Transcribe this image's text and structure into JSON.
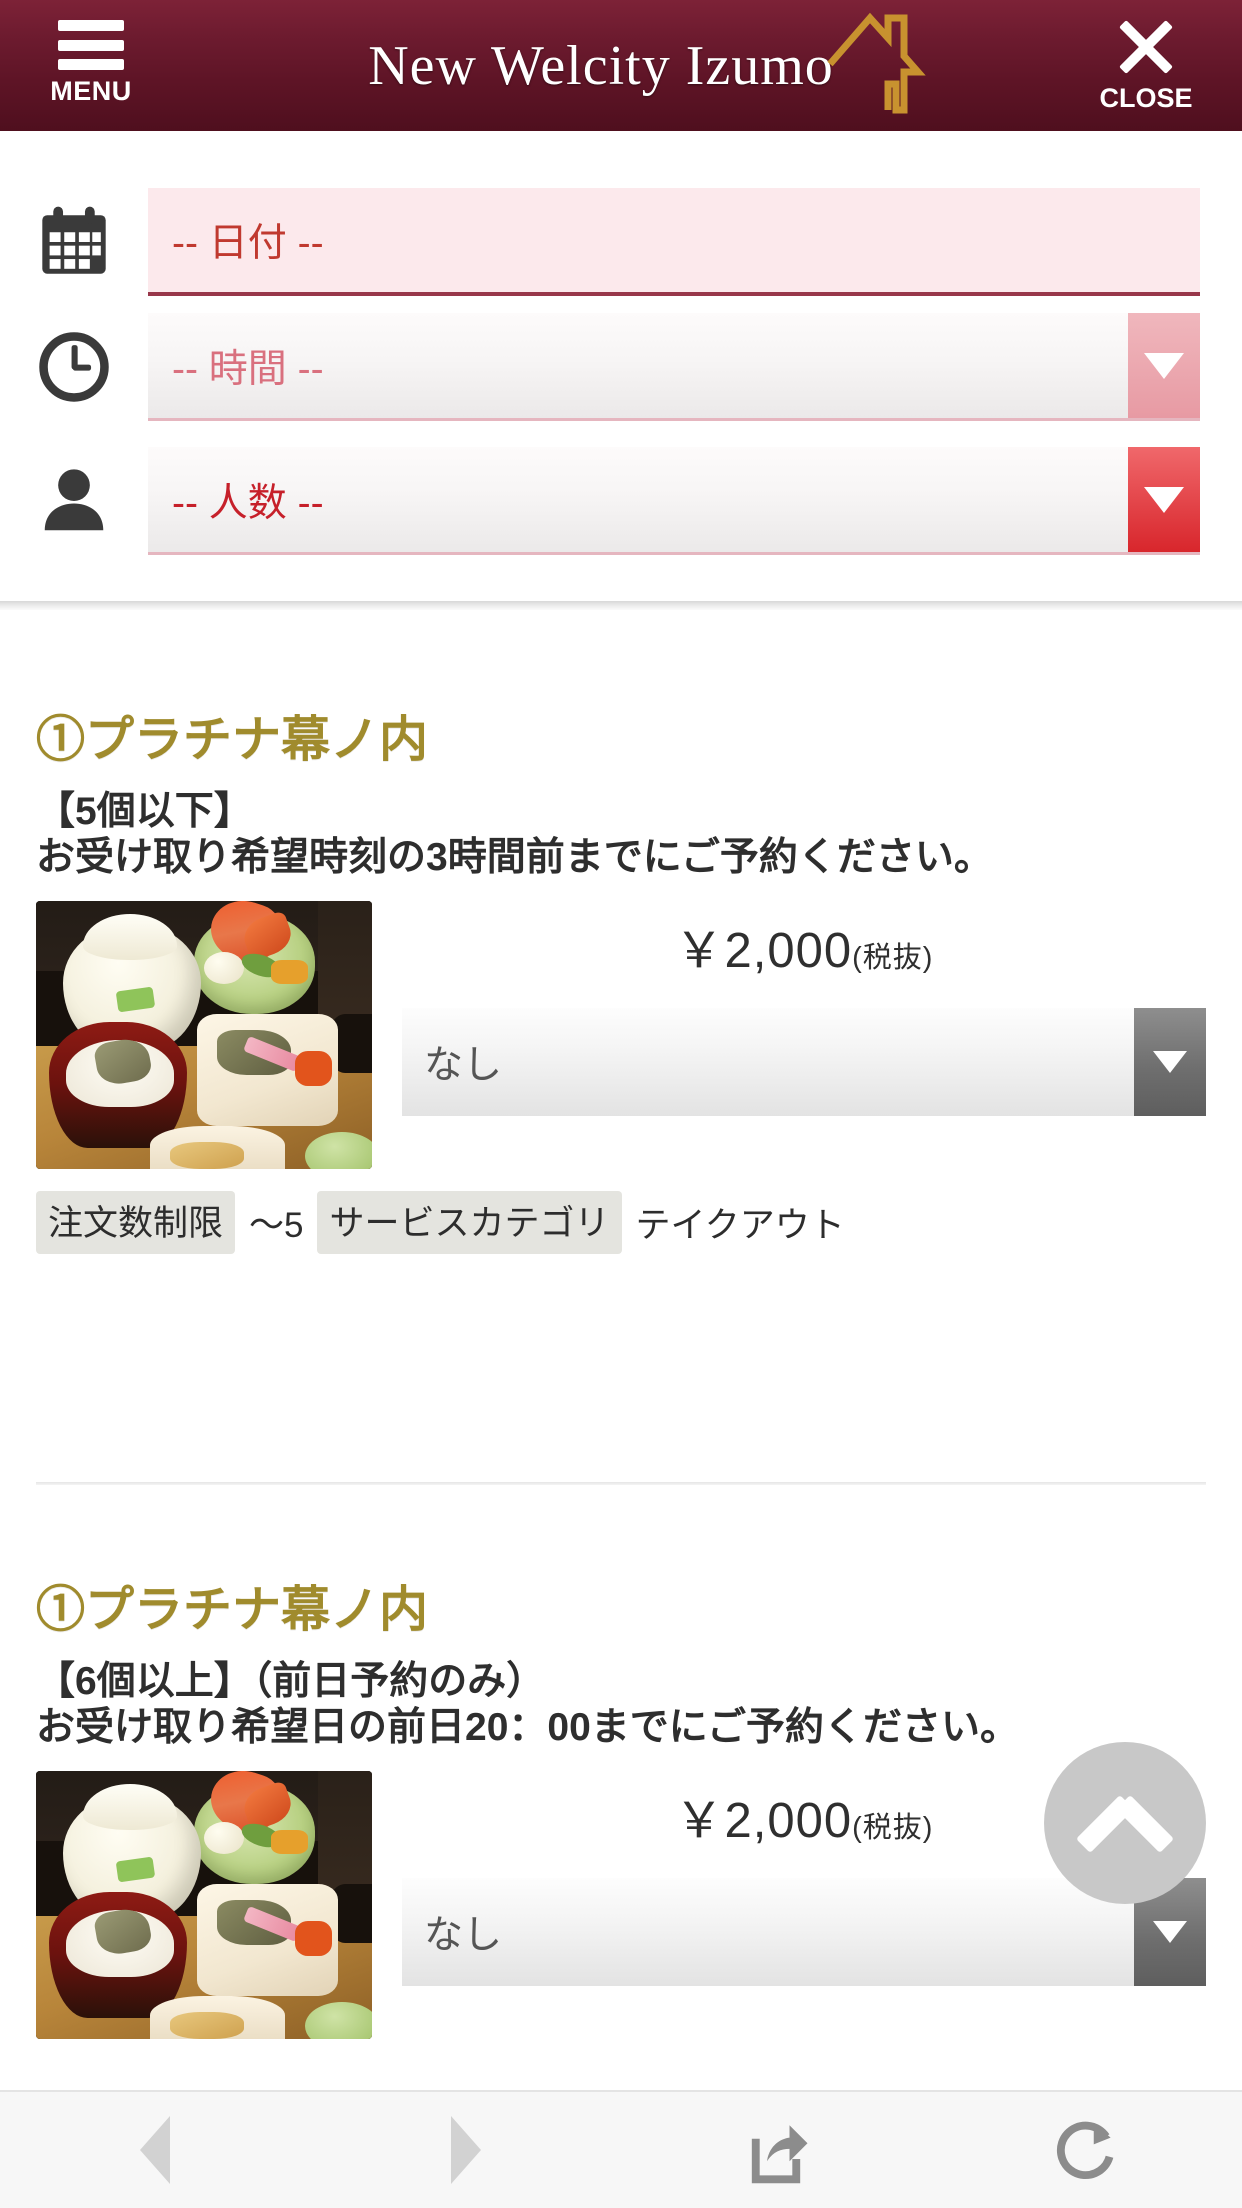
{
  "header": {
    "menu_label": "MENU",
    "title": "New Welcity Izumo",
    "close_label": "CLOSE",
    "brand_color": "#5e1426",
    "logo_color": "#c8922f"
  },
  "search_form": {
    "date": {
      "icon": "calendar-icon",
      "placeholder": "-- 日付 --",
      "value": "-- 日付 --"
    },
    "time": {
      "icon": "clock-icon",
      "placeholder": "-- 時間 --",
      "value": "-- 時間 --"
    },
    "people": {
      "icon": "person-icon",
      "placeholder": "-- 人数 --",
      "value": "-- 人数 --"
    }
  },
  "products": [
    {
      "title": "①プラチナ幕ノ内",
      "desc_line1": "【5個以下】",
      "desc_line2": "お受け取り希望時刻の3時間前までにご予約ください。",
      "price": "￥2,000",
      "tax_note": "(税抜)",
      "qty_value": "なし",
      "tags": [
        {
          "label": "注文数制限",
          "value": "～5"
        },
        {
          "label": "サービスカテゴリ",
          "value": "テイクアウト"
        }
      ]
    },
    {
      "title": "①プラチナ幕ノ内",
      "desc_line1": "【6個以上】（前日予約のみ）",
      "desc_line2": "お受け取り希望日の前日20：00までにご予約ください。",
      "price": "￥2,000",
      "tax_note": "(税抜)",
      "qty_value": "なし",
      "tags": []
    }
  ],
  "scroll_top": {
    "icon": "chevron-up-icon"
  },
  "bottom_bar": {
    "items": [
      {
        "icon": "back-arrow-icon",
        "label": ""
      },
      {
        "icon": "forward-arrow-icon",
        "label": ""
      },
      {
        "icon": "share-icon",
        "label": ""
      },
      {
        "icon": "reload-icon",
        "label": ""
      }
    ]
  }
}
